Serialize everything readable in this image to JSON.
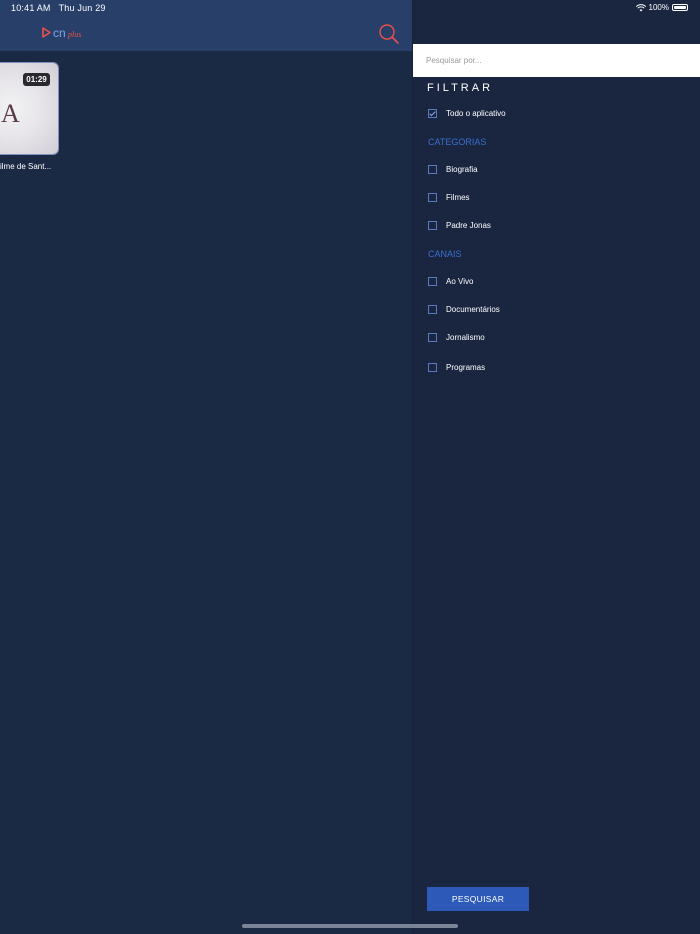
{
  "status_bar": {
    "time": "10:41 AM",
    "date": "Thu Jun 29",
    "battery": "100%",
    "wifi_icon": "wifi-icon",
    "battery_icon": "battery-icon"
  },
  "header": {
    "logo_text": "cn",
    "logo_suffix": "plus",
    "search_icon": "search-icon"
  },
  "video": {
    "duration": "01:29",
    "title": "ilme de Sant...",
    "thumb_letter": "A"
  },
  "filter_panel": {
    "search_placeholder": "Pesquisar por...",
    "search_value": "",
    "heading": "FILTRAR",
    "all_app": {
      "label": "Todo o aplicativo",
      "checked": true
    },
    "categories_label": "CATEGORIAS",
    "categories": [
      {
        "label": "Biografia",
        "checked": false
      },
      {
        "label": "Filmes",
        "checked": false
      },
      {
        "label": "Padre Jonas",
        "checked": false
      }
    ],
    "channels_label": "CANAIS",
    "channels": [
      {
        "label": "Ao Vivo",
        "checked": false
      },
      {
        "label": "Documentários",
        "checked": false
      },
      {
        "label": "Jornalismo",
        "checked": false
      },
      {
        "label": "Programas",
        "checked": false
      }
    ],
    "submit_label": "PESQUISAR"
  },
  "colors": {
    "header_bg": "#283f6a",
    "panel_bg": "#1a2640",
    "accent_blue": "#2d5ab8",
    "section_blue": "#3a6fd0",
    "logo_red": "#e8514a"
  }
}
